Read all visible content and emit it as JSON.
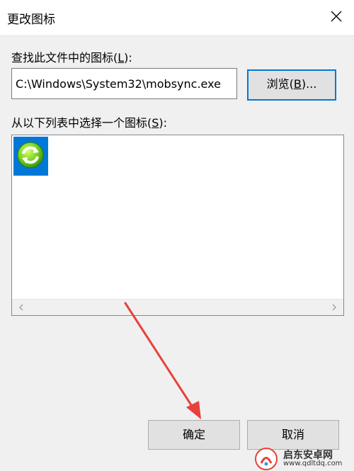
{
  "dialog": {
    "title": "更改图标",
    "find_label": "查找此文件中的图标(",
    "find_label_key": "L",
    "find_label_end": "):",
    "file_path": "C:\\Windows\\System32\\mobsync.exe",
    "browse": {
      "text": "浏览(",
      "key": "B",
      "end": ")..."
    },
    "list_label": "从以下列表中选择一个图标(",
    "list_label_key": "S",
    "list_label_end": "):",
    "icons": [
      {
        "name": "sync-icon",
        "selected": true
      }
    ],
    "ok_button": "确定",
    "cancel_button": "取消"
  },
  "watermark": {
    "cn": "启东安卓网",
    "url": "www.qdltdq.com"
  },
  "colors": {
    "selection": "#0078d7",
    "annotation_arrow": "#e8413c",
    "button_face": "#e1e1e1"
  }
}
